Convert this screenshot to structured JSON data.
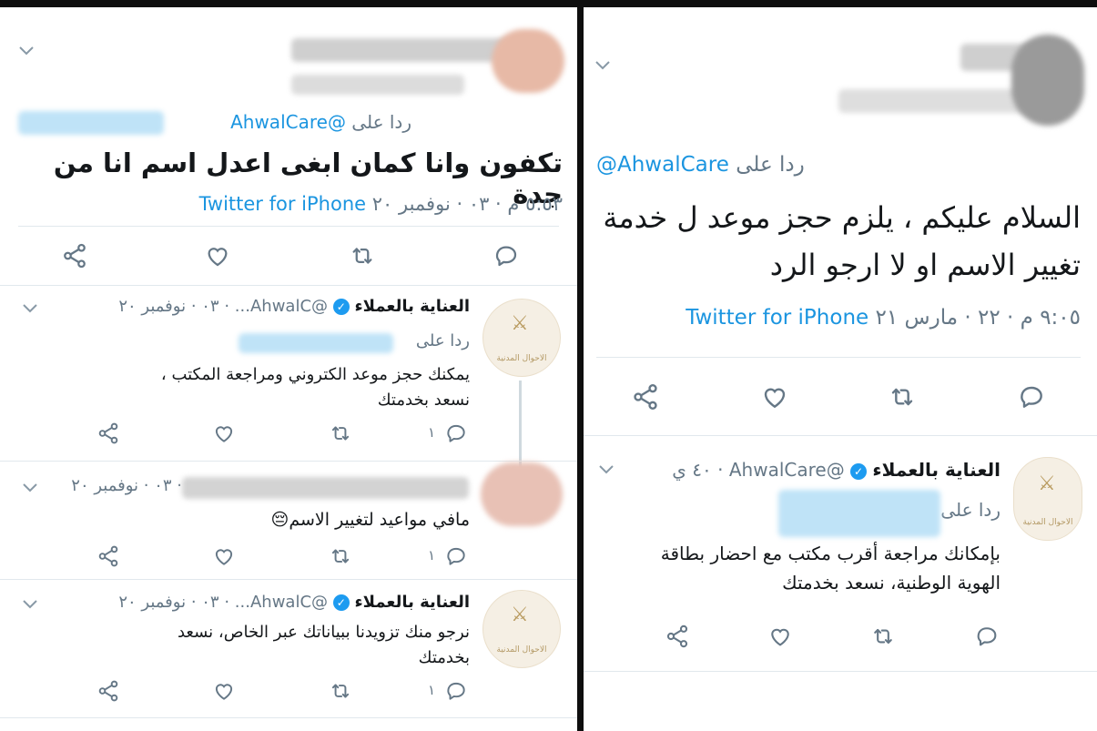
{
  "left_panel": {
    "main_tweet": {
      "reply_prefix": "ردا على",
      "reply_handle": "@AhwalCare",
      "text": "تكفون وانا كمان ابغى اعدل اسم انا من جدة",
      "timestamp": "٥:٥٣ م · ٠٣ · نوفمبر ٢٠",
      "source": "Twitter for iPhone"
    },
    "replies": [
      {
        "author": "العناية بالعملاء",
        "handle": "@AhwalC...",
        "date": "· ٠٣ · نوفمبر ٢٠",
        "reply_prefix": "ردا على",
        "text_line1": "يمكنك حجز موعد الكتروني ومراجعة المكتب ،",
        "text_line2": "نسعد بخدمتك",
        "reply_count": "١",
        "avatar_label": "الاحوال المدنية"
      },
      {
        "date": "· ٠٣ · نوفمبر ٢٠",
        "text": "مافي مواعيد لتغيير الاسم😔",
        "reply_count": "١"
      },
      {
        "author": "العناية بالعملاء",
        "handle": "@AhwalC...",
        "date": "· ٠٣ · نوفمبر ٢٠",
        "text_line1": "نرجو منك تزويدنا ببياناتك عبر الخاص، نسعد",
        "text_line2": "بخدمتك",
        "reply_count": "١",
        "avatar_label": "الاحوال المدنية"
      }
    ]
  },
  "right_panel": {
    "main_tweet": {
      "reply_prefix": "ردا على",
      "reply_handle": "@AhwalCare",
      "text_line1": "السلام عليكم ، يلزم حجز موعد ل خدمة",
      "text_line2": "تغيير الاسم او لا ارجو الرد",
      "timestamp": "٩:٠٥ م · ٢٢ · مارس ٢١",
      "source": "Twitter for iPhone"
    },
    "reply": {
      "author": "العناية بالعملاء",
      "handle": "@AhwalCare",
      "age": "· ٤٠ ي",
      "reply_prefix": "ردا على",
      "text_line1": "بإمكانك مراجعة أقرب مكتب مع احضار بطاقة",
      "text_line2": "الهوية الوطنية، نسعد بخدمتك",
      "avatar_label": "الاحوال المدنية"
    }
  },
  "icons": [
    "share-icon",
    "like-icon",
    "retweet-icon",
    "reply-icon",
    "chevron-down-icon",
    "verified-icon"
  ],
  "colors": {
    "link": "#1b95e0",
    "muted": "#657786",
    "verified": "#1d9bf0",
    "divider": "#e1e8ed"
  }
}
